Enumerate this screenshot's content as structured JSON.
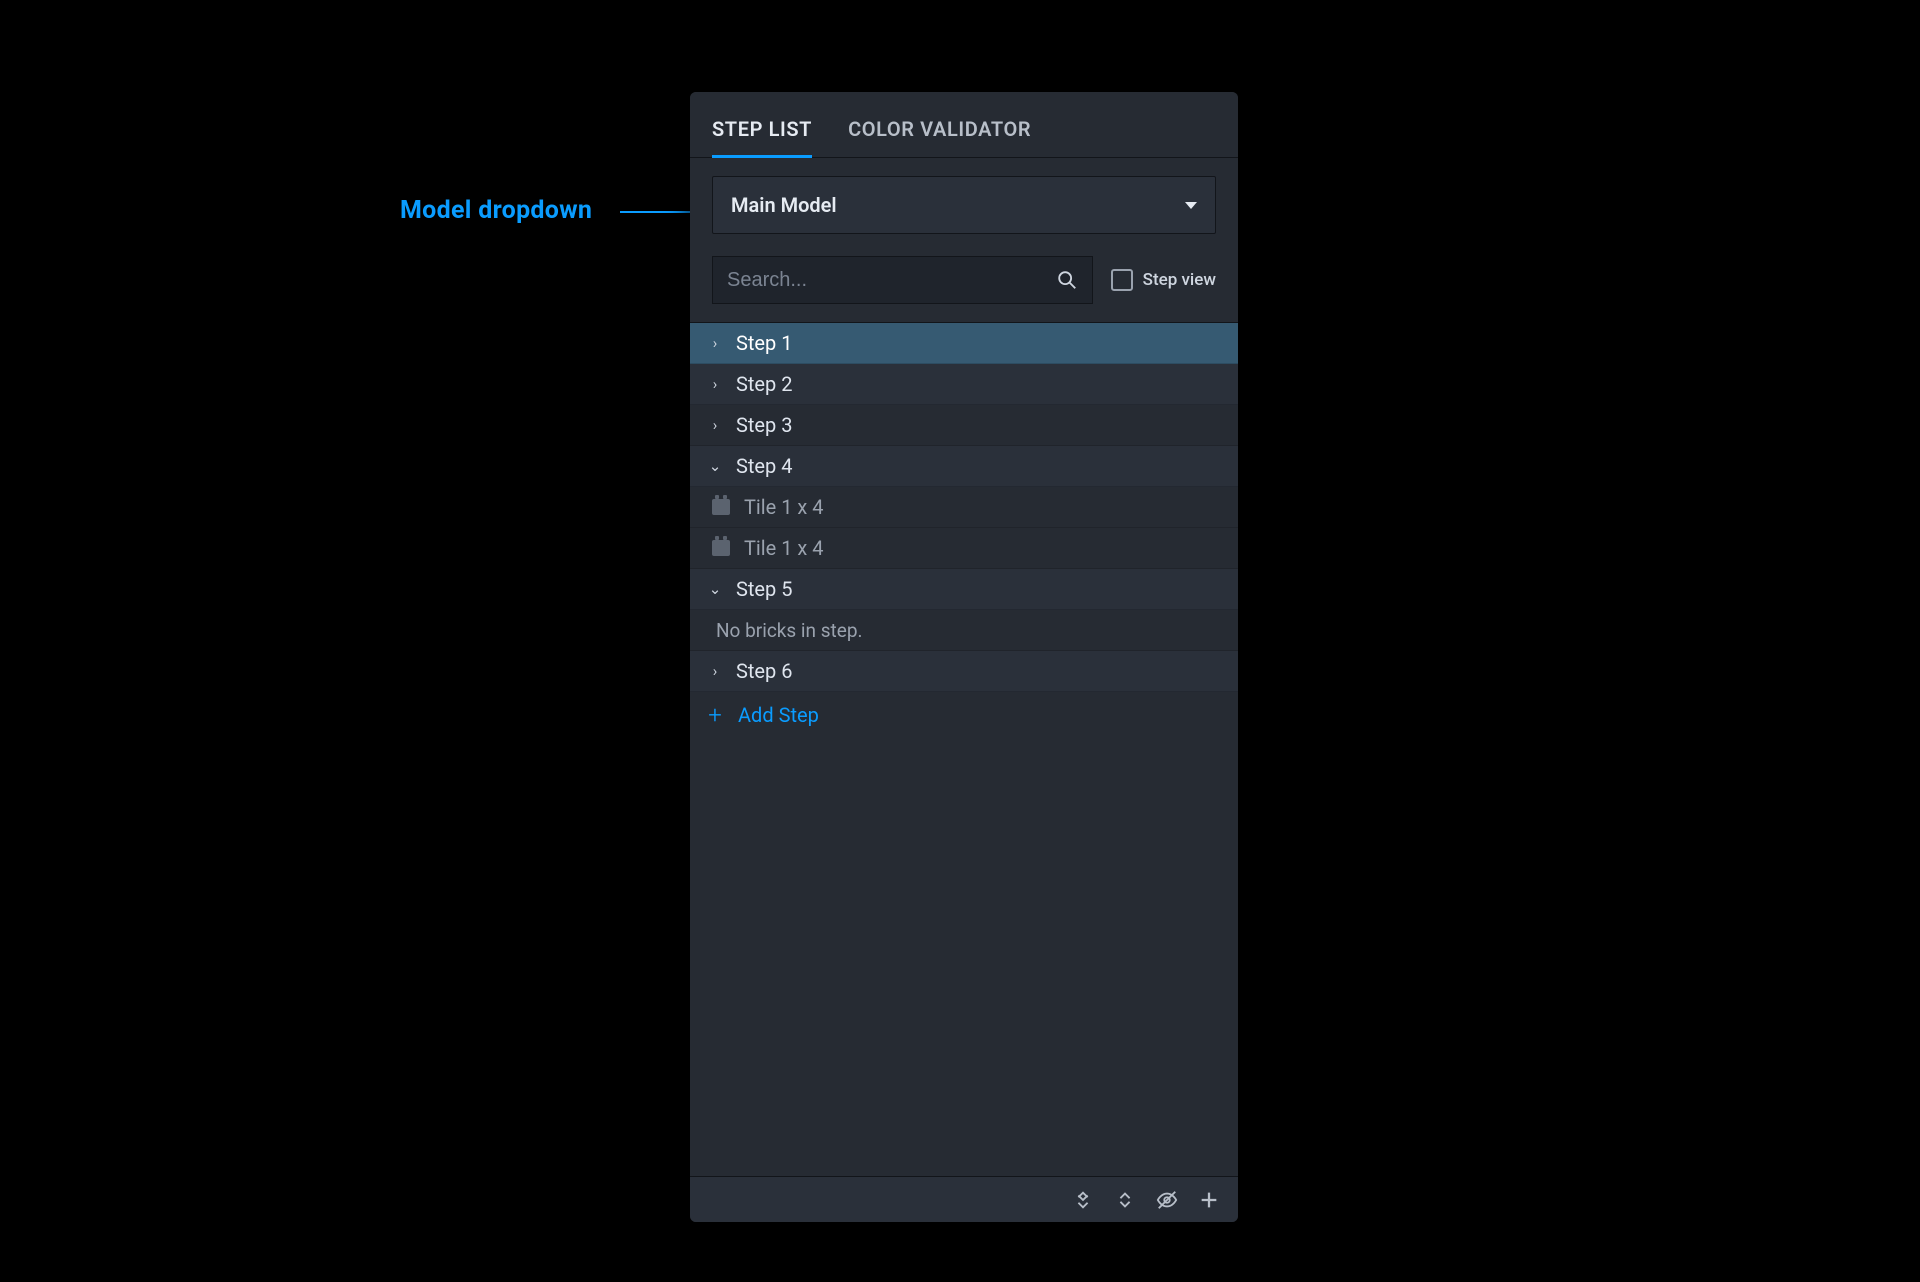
{
  "annotation": {
    "label": "Model dropdown"
  },
  "tabs": [
    {
      "label": "STEP LIST",
      "active": true
    },
    {
      "label": "COLOR VALIDATOR",
      "active": false
    }
  ],
  "model_dropdown": {
    "selected": "Main Model"
  },
  "search": {
    "placeholder": "Search..."
  },
  "step_view": {
    "label": "Step view",
    "checked": false
  },
  "steps": [
    {
      "label": "Step 1",
      "expanded": false,
      "selected": true
    },
    {
      "label": "Step 2",
      "expanded": false
    },
    {
      "label": "Step 3",
      "expanded": false
    },
    {
      "label": "Step 4",
      "expanded": true,
      "children": [
        {
          "type": "brick",
          "label": "Tile 1 x 4"
        },
        {
          "type": "brick",
          "label": "Tile 1 x 4"
        }
      ]
    },
    {
      "label": "Step 5",
      "expanded": true,
      "empty_text": "No bricks in step."
    },
    {
      "label": "Step 6",
      "expanded": false
    }
  ],
  "add_step": {
    "label": "Add Step"
  },
  "footer_icons": [
    "collapse-all",
    "expand-all",
    "visibility-off",
    "add"
  ]
}
